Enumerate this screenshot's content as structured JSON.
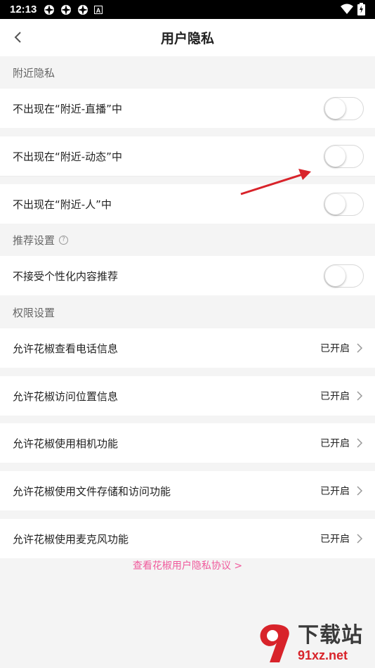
{
  "status_bar": {
    "time": "12:13",
    "icons": [
      "pinwheel-icon",
      "pinwheel-icon",
      "pinwheel-icon",
      "a-badge-icon"
    ],
    "right_icons": [
      "wifi-icon",
      "battery-charging-icon"
    ]
  },
  "header": {
    "title": "用户隐私",
    "back_icon": "back-chevron-icon"
  },
  "nearby_privacy": {
    "section_title": "附近隐私",
    "items": [
      {
        "label": "不出现在“附近-直播”中",
        "enabled": false
      },
      {
        "label": "不出现在“附近-动态”中",
        "enabled": false
      },
      {
        "label": "不出现在“附近-人”中",
        "enabled": false
      }
    ]
  },
  "recommend_settings": {
    "section_title": "推荐设置",
    "help_icon": "question-circle-icon",
    "items": [
      {
        "label": "不接受个性化内容推荐",
        "enabled": false
      }
    ]
  },
  "permission_settings": {
    "section_title": "权限设置",
    "items": [
      {
        "label": "允许花椒查看电话信息",
        "value": "已开启"
      },
      {
        "label": "允许花椒访问位置信息",
        "value": "已开启"
      },
      {
        "label": "允许花椒使用相机功能",
        "value": "已开启"
      },
      {
        "label": "允许花椒使用文件存储和访问功能",
        "value": "已开启"
      },
      {
        "label": "允许花椒使用麦克风功能",
        "value": "已开启"
      }
    ]
  },
  "footer": {
    "policy_link": "查看花椒用户隐私协议 >"
  },
  "watermark": {
    "text": "下载站",
    "url": "91xz.net"
  },
  "colors": {
    "accent_pink": "#f05a9c",
    "background": "#f4f4f4",
    "arrow_red": "#d8232a"
  }
}
